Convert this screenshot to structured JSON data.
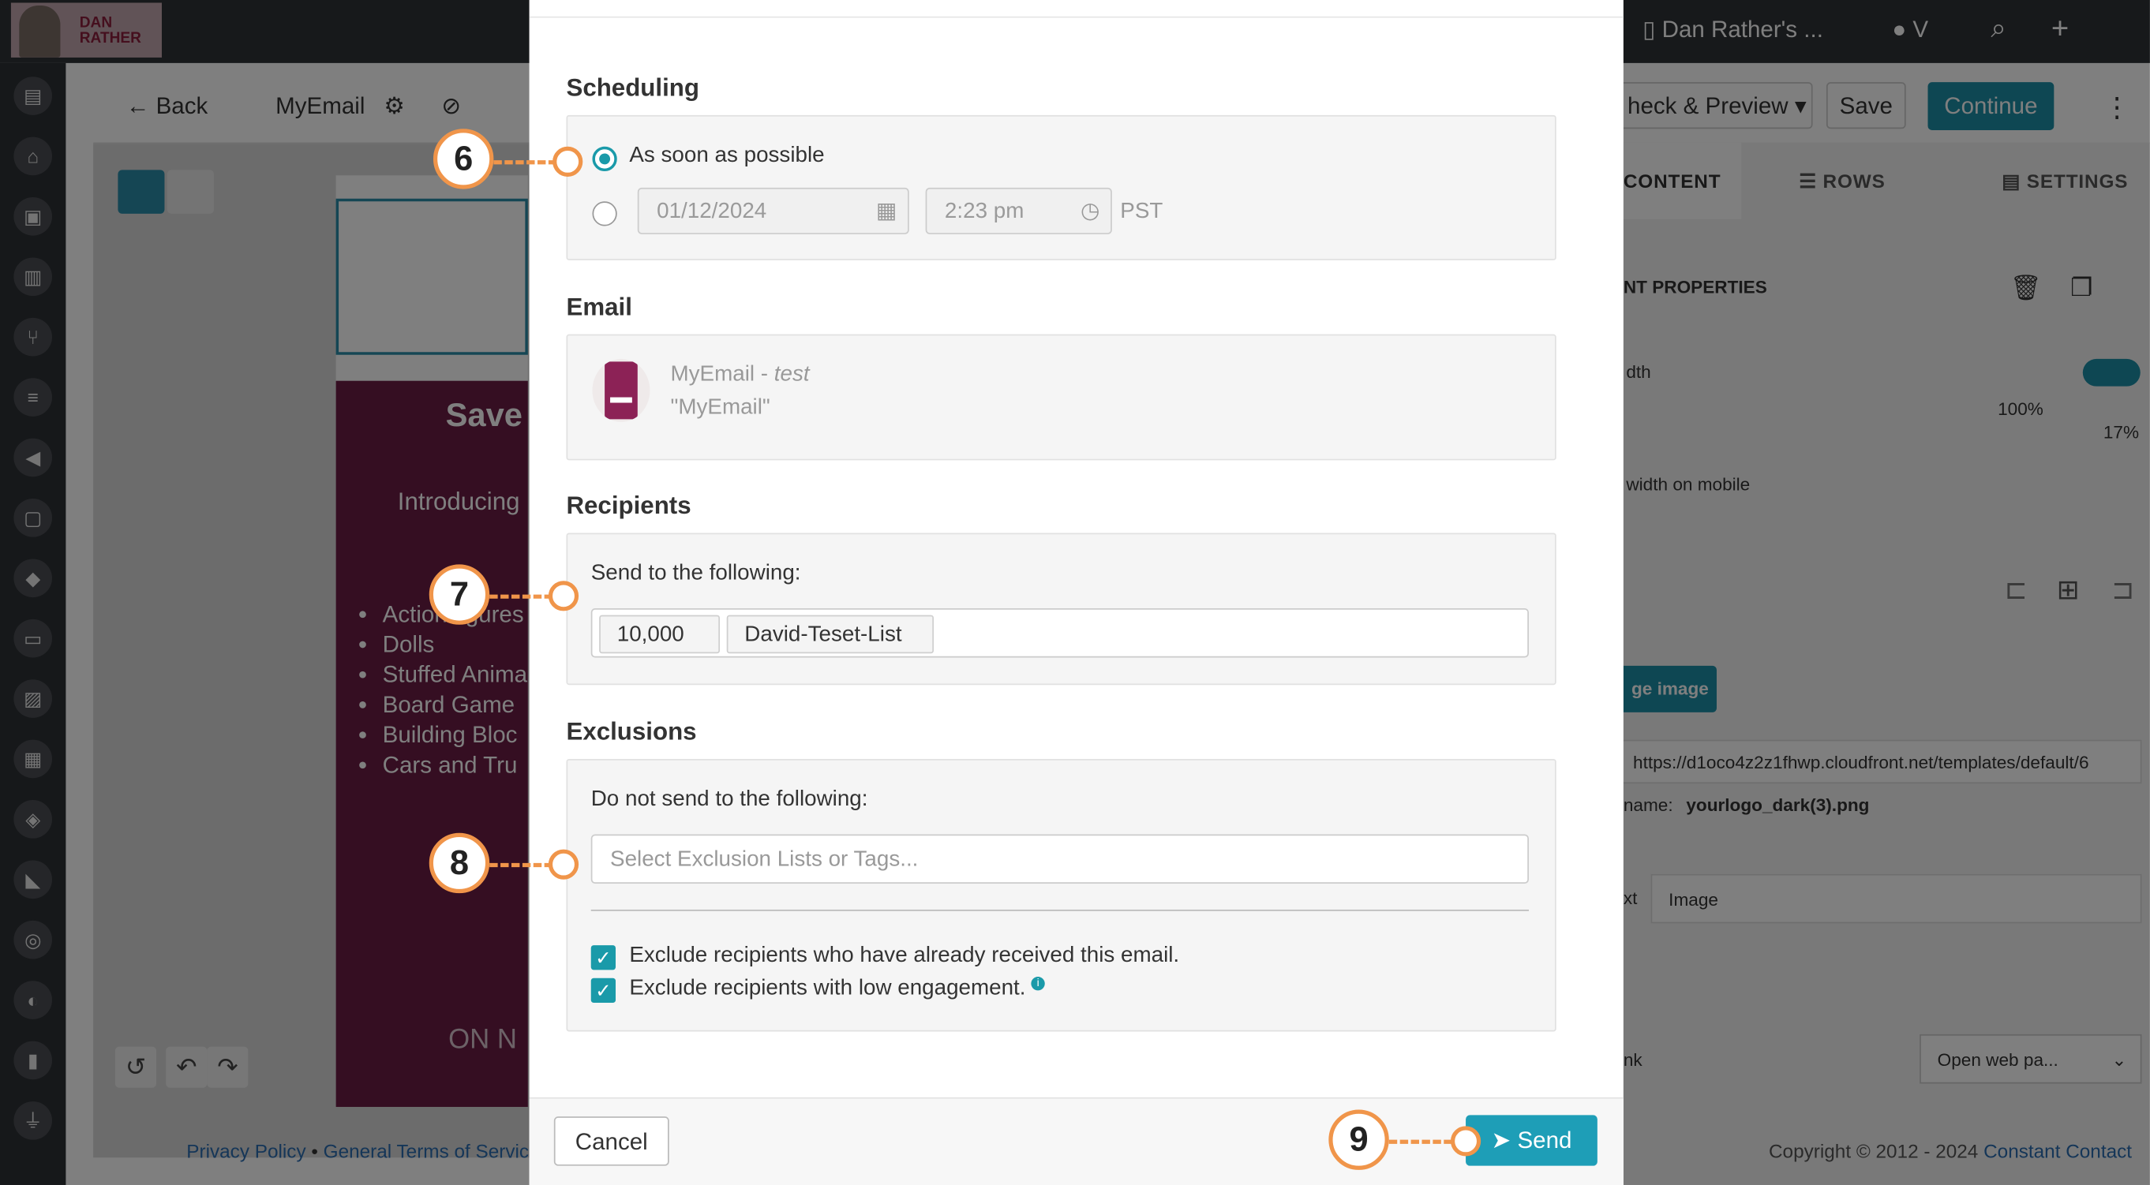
{
  "background": {
    "brand_name": "DAN RATHER",
    "account_name": "Dan Rather's ...",
    "user_initial": "V",
    "back_label": "Back",
    "email_name": "MyEmail",
    "check_preview_label": "heck & Preview",
    "save_label": "Save",
    "continue_label": "Continue",
    "tabs": [
      "CONTENT",
      "ROWS",
      "SETTINGS"
    ],
    "panel_heading": "NT PROPERTIES",
    "width_label": "dth",
    "width_value": "100%",
    "mobile_value": "17%",
    "mobile_label": "width on mobile",
    "change_image_label": "ge image",
    "image_url": "https://d1oco4z2z1fhwp.cloudfront.net/templates/default/6",
    "filename_label": "name:",
    "filename_value": "yourlogo_dark(3).png",
    "alt_label": "xt",
    "alt_value": "Image",
    "link_label": "nk",
    "link_select": "Open web pa...",
    "preview_heading": "Save",
    "preview_intro": "Introducing",
    "preview_items": [
      "Action figures",
      "Dolls",
      "Stuffed Anima",
      "Board Game",
      "Building Bloc",
      "Cars and Tru"
    ],
    "preview_footer": "ON N",
    "footer_privacy": "Privacy Policy",
    "footer_terms": "General Terms of Service",
    "copyright": "Copyright © 2012 - 2024",
    "copyright_link": "Constant Contact"
  },
  "modal": {
    "scheduling": {
      "title": "Scheduling",
      "option_asap": "As soon as possible",
      "date": "01/12/2024",
      "time": "2:23 pm",
      "timezone": "PST"
    },
    "email": {
      "title": "Email",
      "name": "MyEmail",
      "separator": " - ",
      "tag": "test",
      "subject": "\"MyEmail\""
    },
    "recipients": {
      "title": "Recipients",
      "label": "Send to the following:",
      "count": "10,000",
      "list_name": "David-Teset-List"
    },
    "exclusions": {
      "title": "Exclusions",
      "label": "Do not send to the following:",
      "placeholder": "Select Exclusion Lists or Tags...",
      "check1": "Exclude recipients who have already received this email.",
      "check2": "Exclude recipients with low engagement."
    },
    "cancel_label": "Cancel",
    "send_label": "Send"
  },
  "callouts": [
    "6",
    "7",
    "8",
    "9"
  ],
  "colors": {
    "accent": "#1a9aa9",
    "callout": "#f0954a",
    "email_block": "#6b1d45"
  }
}
